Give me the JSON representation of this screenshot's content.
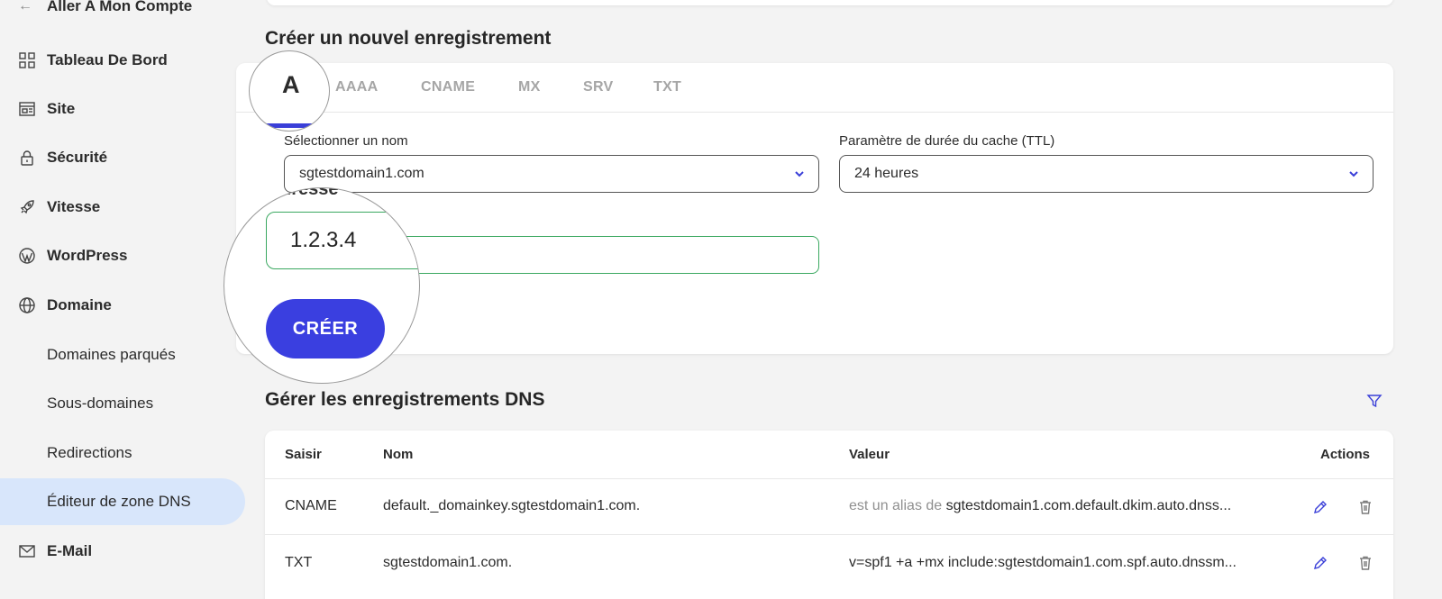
{
  "sidebar": {
    "back_label": "Aller A Mon Compte",
    "items": [
      {
        "label": "Tableau De Bord",
        "icon": "grid-icon"
      },
      {
        "label": "Site",
        "icon": "site-icon"
      },
      {
        "label": "Sécurité",
        "icon": "lock-icon"
      },
      {
        "label": "Vitesse",
        "icon": "rocket-icon"
      },
      {
        "label": "WordPress",
        "icon": "wordpress-icon"
      },
      {
        "label": "Domaine",
        "icon": "globe-icon"
      }
    ],
    "sub_items": [
      {
        "label": "Domaines parqués"
      },
      {
        "label": "Sous-domaines"
      },
      {
        "label": "Redirections"
      },
      {
        "label": "Éditeur de zone DNS",
        "active": true
      }
    ],
    "email": {
      "label": "E-Mail",
      "icon": "mail-icon"
    }
  },
  "create": {
    "title": "Créer un nouvel enregistrement",
    "tabs": [
      "A",
      "AAAA",
      "CNAME",
      "MX",
      "SRV",
      "TXT"
    ],
    "active_tab": "A",
    "name_label": "Sélectionner un nom",
    "name_value": "sgtestdomain1.com",
    "ttl_label": "Paramètre de durée du cache (TTL)",
    "ttl_value": "24 heures",
    "ip_label_partial": "dresse",
    "ip_value": "1.2.3.4",
    "create_button": "CRÉER"
  },
  "manage": {
    "title": "Gérer les enregistrements DNS",
    "columns": [
      "Saisir",
      "Nom",
      "Valeur",
      "Actions"
    ],
    "rows": [
      {
        "type": "CNAME",
        "name": "default._domainkey.sgtestdomain1.com.",
        "value_prefix": "est un alias de",
        "value": "sgtestdomain1.com.default.dkim.auto.dnss..."
      },
      {
        "type": "TXT",
        "name": "sgtestdomain1.com.",
        "value_prefix": "",
        "value": "v=spf1 +a +mx include:sgtestdomain1.com.spf.auto.dnssm..."
      }
    ]
  },
  "colors": {
    "accent": "#3a3fe0",
    "active_bg": "#d8e6fb",
    "input_valid": "#3aa860"
  }
}
